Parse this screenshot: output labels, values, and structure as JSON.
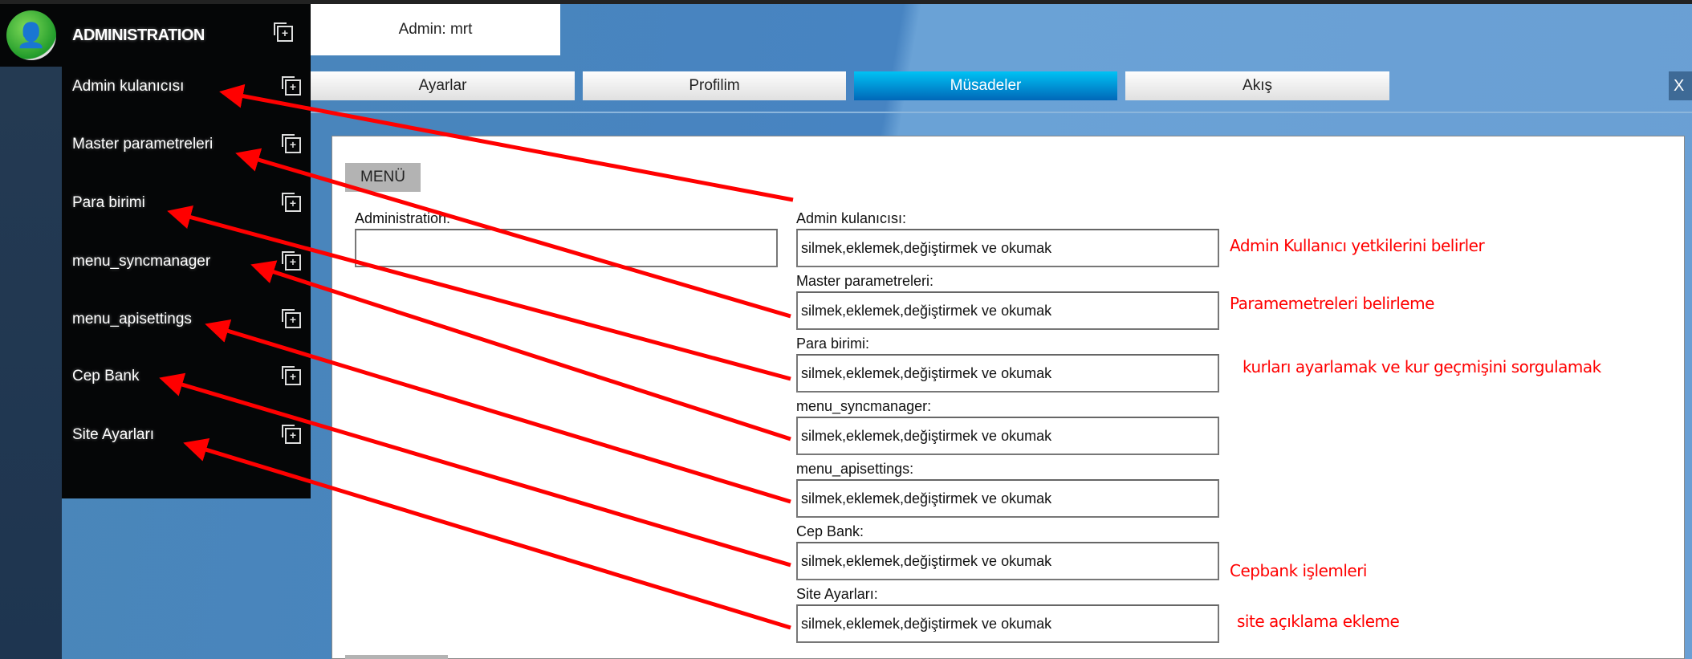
{
  "sidebar": {
    "title": "ADMINISTRATION",
    "items": [
      {
        "label": "Admin kulanıcısı"
      },
      {
        "label": "Master parametreleri"
      },
      {
        "label": "Para birimi"
      },
      {
        "label": "menu_syncmanager"
      },
      {
        "label": "menu_apisettings"
      },
      {
        "label": "Cep Bank"
      },
      {
        "label": "Site Ayarları"
      }
    ]
  },
  "header": {
    "admin_label": "Admin: mrt",
    "close_label": "X"
  },
  "tabs": [
    {
      "label": "Ayarlar"
    },
    {
      "label": "Profilim"
    },
    {
      "label": "Müsadeler"
    },
    {
      "label": "Akış"
    }
  ],
  "main": {
    "menu_button": "MENÜ",
    "admin_label": "Administration:",
    "admin_value": "",
    "permissions": [
      {
        "label": "Admin kulanıcısı:",
        "value": "silmek,eklemek,değiştirmek ve okumak"
      },
      {
        "label": "Master parametreleri:",
        "value": "silmek,eklemek,değiştirmek ve okumak"
      },
      {
        "label": "Para birimi:",
        "value": "silmek,eklemek,değiştirmek ve okumak"
      },
      {
        "label": "menu_syncmanager:",
        "value": "silmek,eklemek,değiştirmek ve okumak"
      },
      {
        "label": "menu_apisettings:",
        "value": "silmek,eklemek,değiştirmek ve okumak"
      },
      {
        "label": "Cep Bank:",
        "value": "silmek,eklemek,değiştirmek ve okumak"
      },
      {
        "label": "Site Ayarları:",
        "value": "silmek,eklemek,değiştirmek ve okumak"
      }
    ]
  },
  "annotations": [
    "Admin Kullanıcı yetkilerini belirler",
    "Paramemetreleri belirleme",
    "kurları ayarlamak ve kur geçmişini sorgulamak",
    "Cepbank işlemleri",
    "site açıklama ekleme"
  ],
  "colors": {
    "accent": "#0a8fd8",
    "annotation": "#ff0000"
  }
}
